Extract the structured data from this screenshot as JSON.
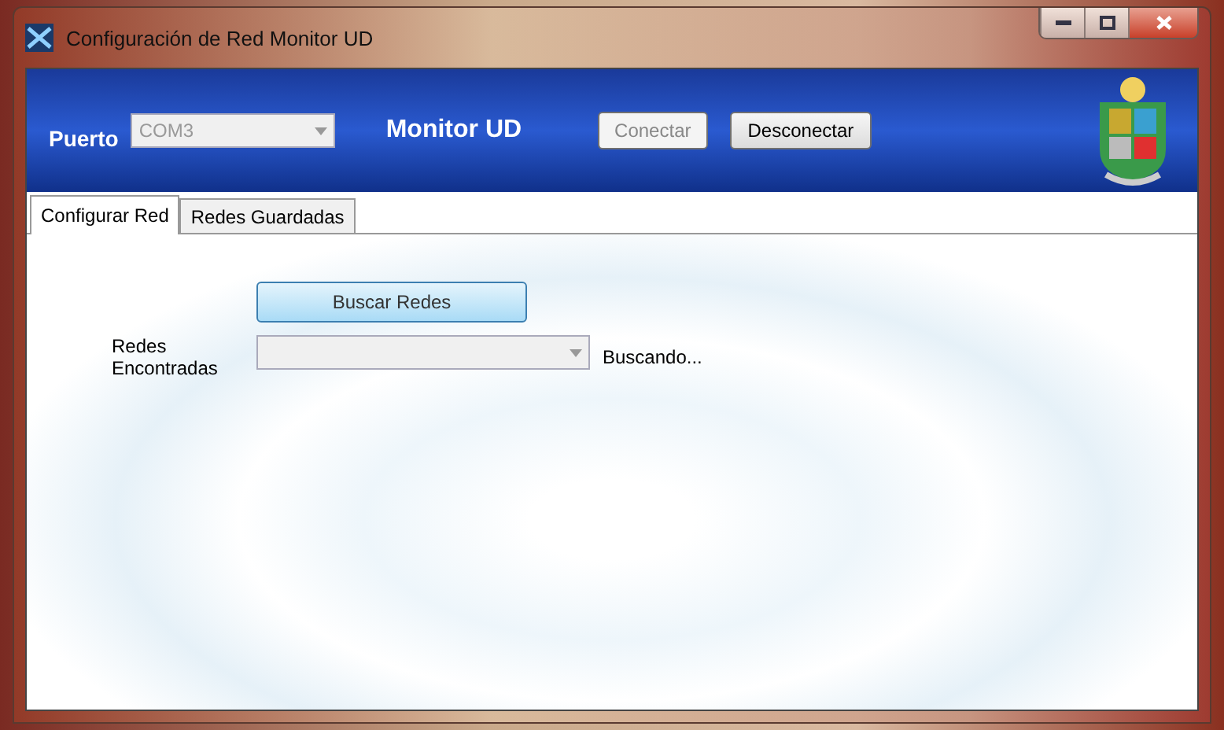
{
  "window": {
    "title": "Configuración de Red Monitor UD"
  },
  "header": {
    "port_label": "Puerto",
    "port_combo": {
      "value": "COM3",
      "disabled": true
    },
    "app_name": "Monitor UD",
    "buttons": [
      {
        "label": "Conectar",
        "disabled": true
      },
      {
        "label": "Desconectar",
        "disabled": false
      }
    ]
  },
  "tabs": [
    {
      "label": "Configurar Red",
      "selected": true
    },
    {
      "label": "Redes Guardadas",
      "selected": false
    }
  ],
  "content": {
    "search_button": {
      "label": "Buscar Redes",
      "focused": true
    },
    "networks_label": "Redes\nEncontradas",
    "networks_combo": {
      "disabled": true
    },
    "status": "Buscando..."
  }
}
